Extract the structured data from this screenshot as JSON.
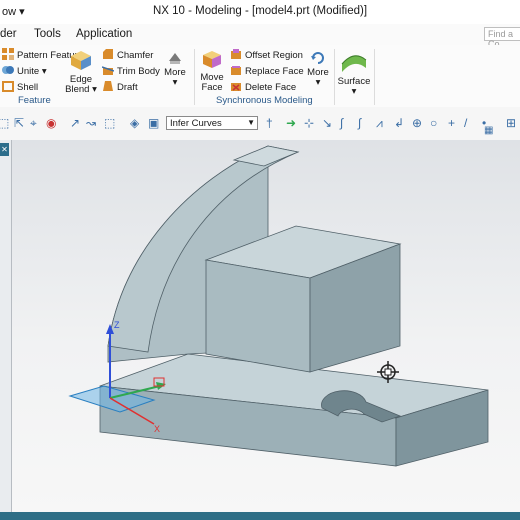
{
  "titlebar": {
    "left_fragment": "ow ▾",
    "title": "NX 10 - Modeling - [model4.prt (Modified)]"
  },
  "menu": {
    "items": [
      "der",
      "Tools",
      "Application"
    ]
  },
  "search": {
    "placeholder": "Find a Co"
  },
  "ribbon": {
    "feature": {
      "pattern_feature": "Pattern Feature",
      "unite": "Unite",
      "shell": "Shell",
      "edge_blend_line1": "Edge",
      "edge_blend_line2": "Blend",
      "chamfer": "Chamfer",
      "trim_body": "Trim Body",
      "draft": "Draft",
      "more": "More",
      "group_label": "Feature"
    },
    "sync": {
      "move_face_line1": "Move",
      "move_face_line2": "Face",
      "offset_region": "Offset Region",
      "replace_face": "Replace Face",
      "delete_face": "Delete Face",
      "more": "More",
      "group_label": "Synchronous Modeling"
    },
    "surface": {
      "label": "Surface"
    }
  },
  "selection_bar": {
    "curve_rule": "Infer Curves"
  },
  "axes": {
    "z": "Z",
    "x": "X"
  },
  "colors": {
    "part_top": "#c5d3d8",
    "part_side": "#8ea2a9",
    "accent": "#2e6e86",
    "axis_x": "#e03030",
    "axis_y": "#2fa84f",
    "axis_z": "#2f4fd8"
  }
}
